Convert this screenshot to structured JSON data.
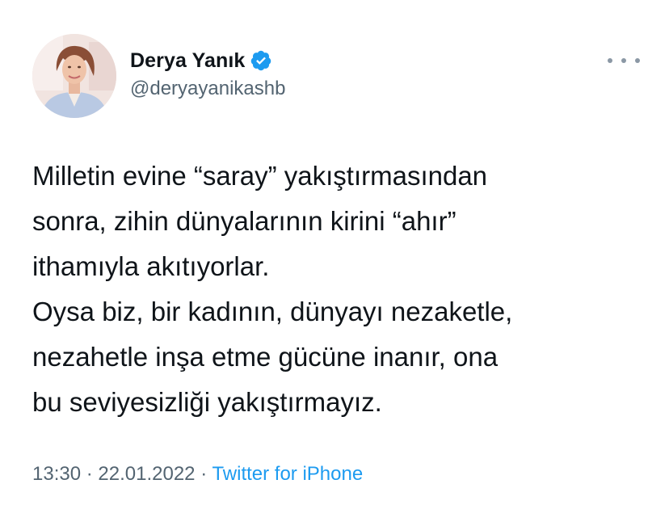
{
  "tweet": {
    "author": {
      "display_name": "Derya Yanık",
      "handle": "@deryayanikashb",
      "verified_icon": "verified-badge-icon",
      "verified_color": "#1d9bf0"
    },
    "more_icon": "more-options-icon",
    "text_lines": [
      "Milletin evine “saray” yakıştırmasından",
      "sonra, zihin dünyalarının kirini “ahır”",
      "ithamıyla akıtıyorlar.",
      "Oysa biz, bir kadının, dünyayı nezaketle,",
      "nezahetle inşa etme gücüne inanır, ona",
      "bu seviyesizliği yakıştırmayız."
    ],
    "meta": {
      "time": "13:30",
      "separator": "·",
      "date": "22.01.2022",
      "source": "Twitter for iPhone"
    }
  },
  "colors": {
    "text": "#0f1419",
    "secondary": "#536471",
    "link": "#1d9bf0"
  }
}
